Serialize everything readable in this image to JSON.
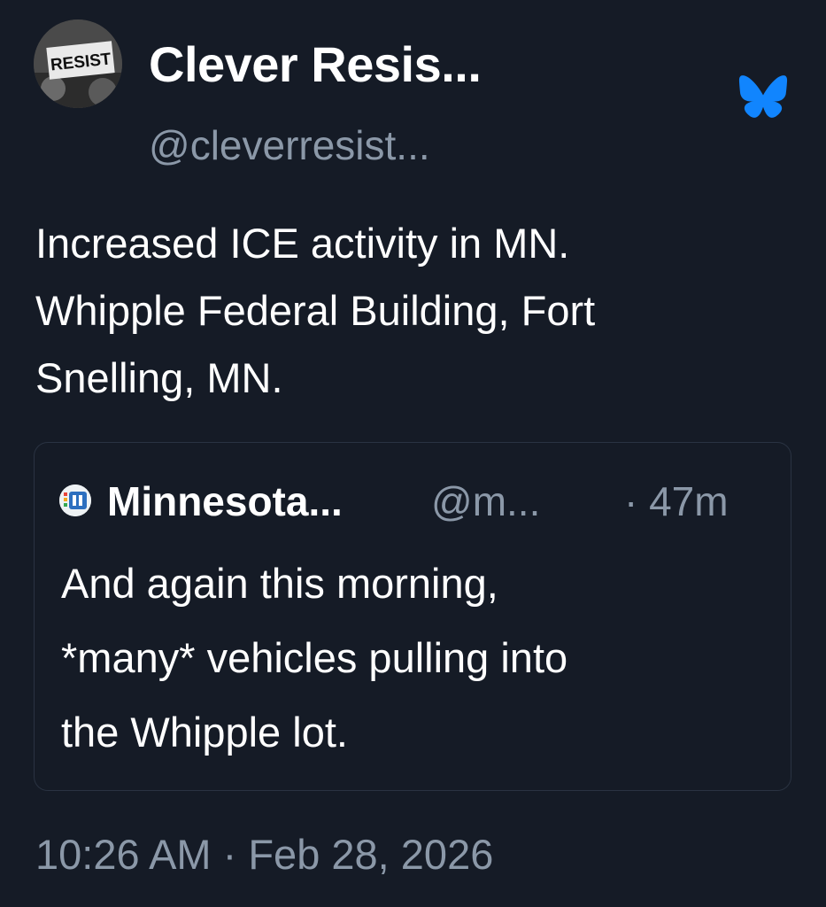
{
  "post": {
    "author": {
      "display_name": "Clever Resis...",
      "handle": "@cleverresist...",
      "avatar_text": "RESIST",
      "avatar_icon": "resist-sign-avatar"
    },
    "platform_icon": "bluesky-butterfly-icon",
    "text_lines": [
      "Increased ICE activity in MN.",
      "Whipple Federal Building, Fort",
      "Snelling, MN."
    ],
    "quote": {
      "author_display_name": "Minnesota...",
      "author_handle": "@m...",
      "time": "· 47m",
      "avatar_icon": "minnesota-news-avatar",
      "text_lines": [
        "And again this morning,",
        "*many* vehicles pulling into",
        "the Whipple lot."
      ]
    },
    "timestamp": "10:26 AM · Feb 28, 2026"
  },
  "colors": {
    "background": "#151b26",
    "text_primary": "#ffffff",
    "text_secondary": "#8b98a8",
    "border": "#2a3342",
    "bluesky_blue": "#1185fe"
  }
}
